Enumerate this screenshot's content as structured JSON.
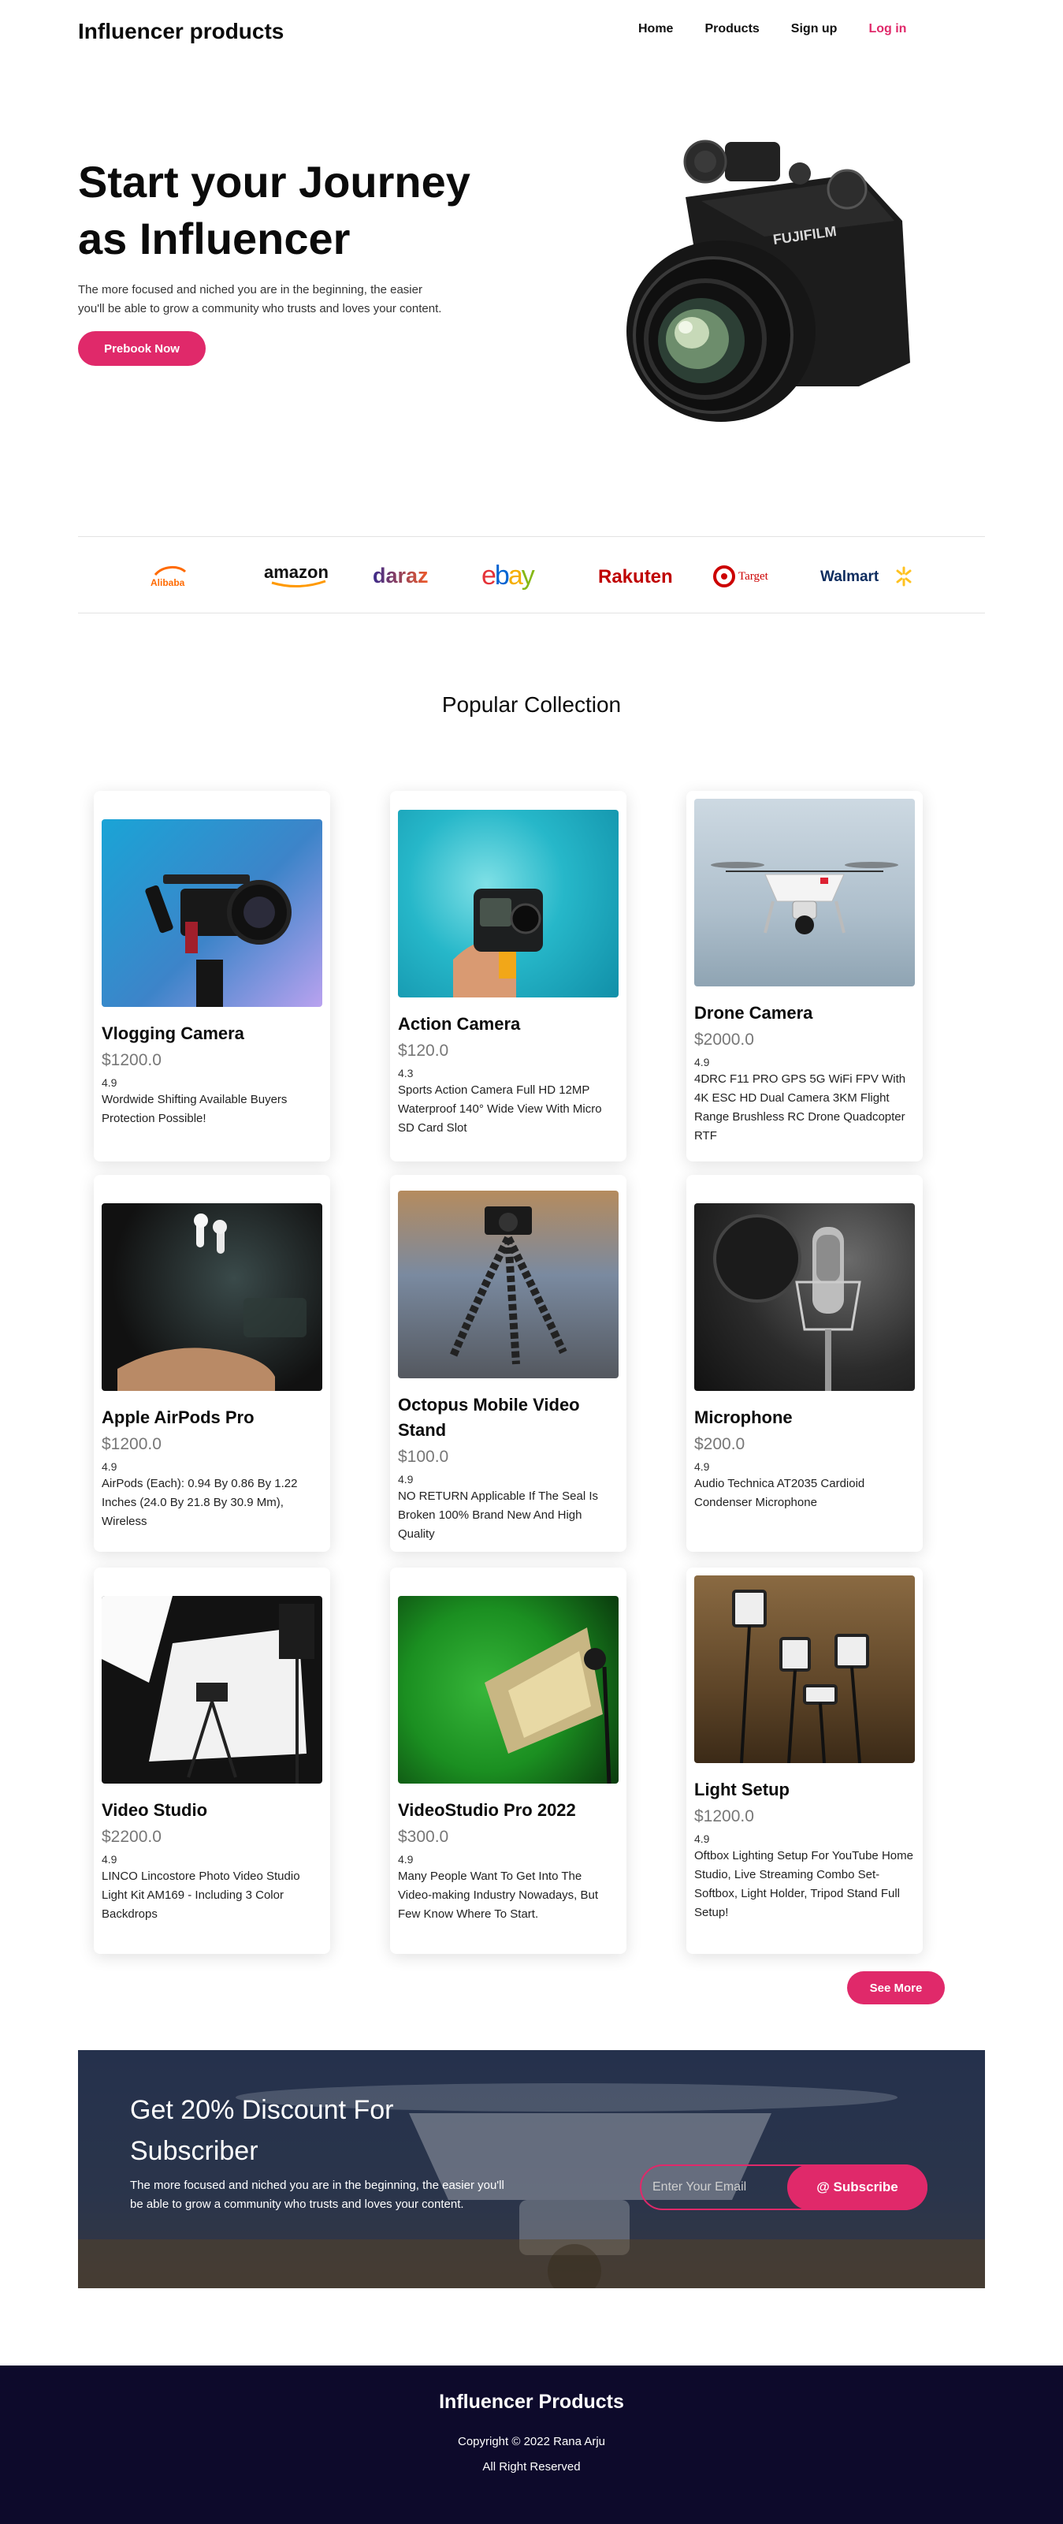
{
  "nav": {
    "brand": "Influencer products",
    "items": [
      {
        "label": "Home"
      },
      {
        "label": "Products"
      },
      {
        "label": "Sign up"
      },
      {
        "label": "Log in"
      }
    ]
  },
  "hero": {
    "title_line1": "Start your Journey",
    "title_line2": "as Influencer",
    "text_line1": "The more focused and niched you are in the beginning, the easier",
    "text_line2": "you'll be able to grow a community who trusts and loves your content.",
    "cta": "Prebook Now",
    "image_icon": "fujifilm-camera",
    "camera_brand_text": "FUJIFILM"
  },
  "brands": [
    "Alibaba",
    "amazon",
    "daraz",
    "ebay",
    "Rakuten",
    "Target",
    "Walmart"
  ],
  "collection": {
    "title": "Popular Collection",
    "products": [
      {
        "name": "Vlogging Camera",
        "price": "$1200.0",
        "rating": "4.9",
        "desc": "Wordwide Shifting Available Buyers Protection Possible!",
        "image": "vlogging-camera"
      },
      {
        "name": "Action Camera",
        "price": "$120.0",
        "rating": "4.3",
        "desc": "Sports Action Camera Full HD 12MP Waterproof 140° Wide View With Micro SD Card Slot",
        "image": "action-camera"
      },
      {
        "name": "Drone Camera",
        "price": "$2000.0",
        "rating": "4.9",
        "desc": "4DRC F11 PRO GPS 5G WiFi FPV With 4K ESC HD Dual Camera 3KM Flight Range Brushless RC Drone Quadcopter RTF",
        "image": "drone"
      },
      {
        "name": "Apple AirPods Pro",
        "price": "$1200.0",
        "rating": "4.9",
        "desc": "AirPods (Each): 0.94 By 0.86 By 1.22 Inches (24.0 By 21.8 By 30.9 Mm), Wireless",
        "image": "airpods"
      },
      {
        "name": "Octopus Mobile Video Stand",
        "price": "$100.0",
        "rating": "4.9",
        "desc": "NO RETURN Applicable If The Seal Is Broken 100% Brand New And High Quality",
        "image": "octopus-tripod"
      },
      {
        "name": "Microphone",
        "price": "$200.0",
        "rating": "4.9",
        "desc": "Audio Technica AT2035 Cardioid Condenser Microphone",
        "image": "microphone"
      },
      {
        "name": "Video Studio",
        "price": "$2200.0",
        "rating": "4.9",
        "desc": "LINCO Lincostore Photo Video Studio Light Kit AM169 - Including 3 Color Backdrops",
        "image": "video-studio"
      },
      {
        "name": "VideoStudio Pro 2022",
        "price": "$300.0",
        "rating": "4.9",
        "desc": "Many People Want To Get Into The Video-making Industry Nowadays, But Few Know Where To Start.",
        "image": "green-screen-softbox"
      },
      {
        "name": "Light Setup",
        "price": "$1200.0",
        "rating": "4.9",
        "desc": "Oftbox Lighting Setup For YouTube Home Studio, Live Streaming Combo Set- Softbox, Light Holder, Tripod Stand Full Setup!",
        "image": "light-setup"
      }
    ],
    "see_more": "See More"
  },
  "subscribe": {
    "title_line1": "Get 20% Discount For",
    "title_line2": "Subscriber",
    "text_line1": "The more focused and niched you are in the beginning, the easier you'll",
    "text_line2": "be able to grow a community who trusts and loves your content.",
    "placeholder": "Enter Your Email",
    "button": "@ Subscribe"
  },
  "footer": {
    "brand": "Influencer Products",
    "copyright": "Copyright © 2022 Rana Arju",
    "rights": "All Right Reserved"
  },
  "colors": {
    "accent": "#e0296a",
    "footer_bg": "#0d0a2b"
  }
}
